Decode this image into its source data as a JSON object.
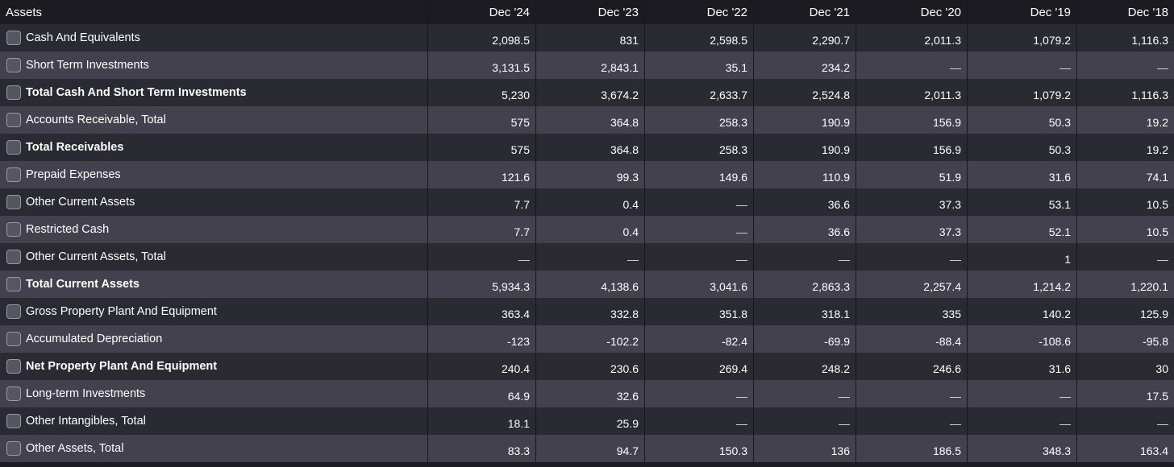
{
  "table": {
    "header": {
      "label": "Assets",
      "columns": [
        "Dec '24",
        "Dec '23",
        "Dec '22",
        "Dec '21",
        "Dec '20",
        "Dec '19",
        "Dec '18"
      ]
    },
    "rows": [
      {
        "label": "Cash And Equivalents",
        "bold": false,
        "values": [
          "2,098.5",
          "831",
          "2,598.5",
          "2,290.7",
          "2,011.3",
          "1,079.2",
          "1,116.3"
        ]
      },
      {
        "label": "Short Term Investments",
        "bold": false,
        "values": [
          "3,131.5",
          "2,843.1",
          "35.1",
          "234.2",
          "—",
          "—",
          "—"
        ]
      },
      {
        "label": "Total Cash And Short Term Investments",
        "bold": true,
        "values": [
          "5,230",
          "3,674.2",
          "2,633.7",
          "2,524.8",
          "2,011.3",
          "1,079.2",
          "1,116.3"
        ]
      },
      {
        "label": "Accounts Receivable, Total",
        "bold": false,
        "values": [
          "575",
          "364.8",
          "258.3",
          "190.9",
          "156.9",
          "50.3",
          "19.2"
        ]
      },
      {
        "label": "Total Receivables",
        "bold": true,
        "values": [
          "575",
          "364.8",
          "258.3",
          "190.9",
          "156.9",
          "50.3",
          "19.2"
        ]
      },
      {
        "label": "Prepaid Expenses",
        "bold": false,
        "values": [
          "121.6",
          "99.3",
          "149.6",
          "110.9",
          "51.9",
          "31.6",
          "74.1"
        ]
      },
      {
        "label": "Other Current Assets",
        "bold": false,
        "values": [
          "7.7",
          "0.4",
          "—",
          "36.6",
          "37.3",
          "53.1",
          "10.5"
        ]
      },
      {
        "label": "Restricted Cash",
        "bold": false,
        "values": [
          "7.7",
          "0.4",
          "—",
          "36.6",
          "37.3",
          "52.1",
          "10.5"
        ]
      },
      {
        "label": "Other Current Assets, Total",
        "bold": false,
        "values": [
          "—",
          "—",
          "—",
          "—",
          "—",
          "1",
          "—"
        ]
      },
      {
        "label": "Total Current Assets",
        "bold": true,
        "values": [
          "5,934.3",
          "4,138.6",
          "3,041.6",
          "2,863.3",
          "2,257.4",
          "1,214.2",
          "1,220.1"
        ]
      },
      {
        "label": "Gross Property Plant And Equipment",
        "bold": false,
        "values": [
          "363.4",
          "332.8",
          "351.8",
          "318.1",
          "335",
          "140.2",
          "125.9"
        ]
      },
      {
        "label": "Accumulated Depreciation",
        "bold": false,
        "values": [
          "-123",
          "-102.2",
          "-82.4",
          "-69.9",
          "-88.4",
          "-108.6",
          "-95.8"
        ]
      },
      {
        "label": "Net Property Plant And Equipment",
        "bold": true,
        "values": [
          "240.4",
          "230.6",
          "269.4",
          "248.2",
          "246.6",
          "31.6",
          "30"
        ]
      },
      {
        "label": "Long-term Investments",
        "bold": false,
        "values": [
          "64.9",
          "32.6",
          "—",
          "—",
          "—",
          "—",
          "17.5"
        ]
      },
      {
        "label": "Other Intangibles, Total",
        "bold": false,
        "values": [
          "18.1",
          "25.9",
          "—",
          "—",
          "—",
          "—",
          "—"
        ]
      },
      {
        "label": "Other Assets, Total",
        "bold": false,
        "values": [
          "83.3",
          "94.7",
          "150.3",
          "136",
          "186.5",
          "348.3",
          "163.4"
        ]
      }
    ]
  },
  "colors": {
    "background": "#1c1b22",
    "row_dark": "#2a2a32",
    "row_light": "#42414d",
    "text": "#ffffff"
  }
}
